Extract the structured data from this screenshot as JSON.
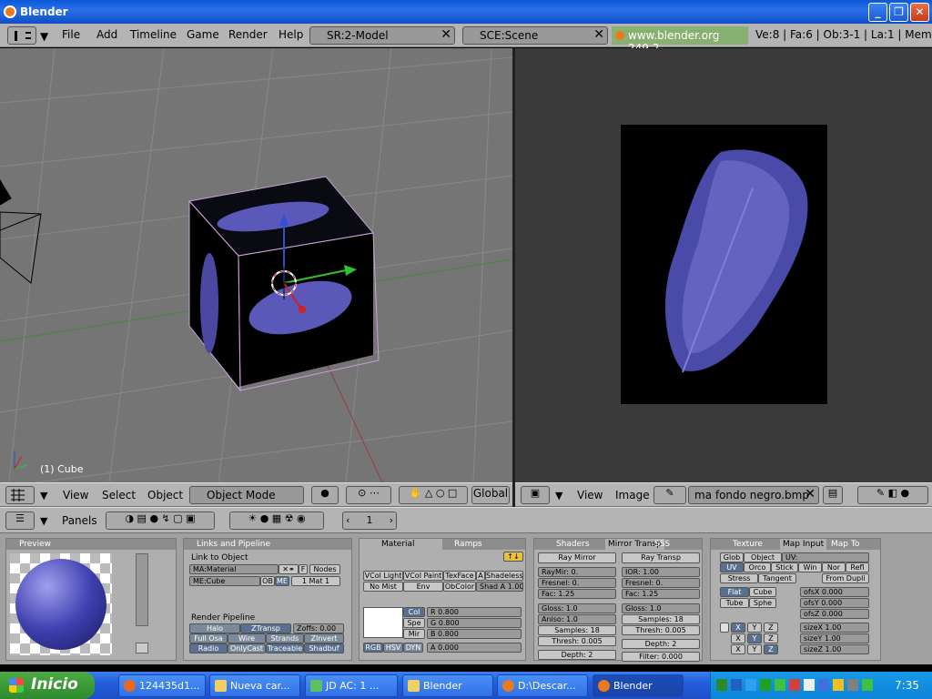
{
  "window": {
    "title": "Blender",
    "minimize": "_",
    "maximize": "❐",
    "close": "✕"
  },
  "menubar": {
    "items": [
      "File",
      "Add",
      "Timeline",
      "Game",
      "Render",
      "Help"
    ],
    "screen_field": "SR:2-Model",
    "scene_field": "SCE:Scene",
    "website": "www.blender.org 249.2",
    "stats": "Ve:8 | Fa:6 | Ob:3-1 | La:1  | Mem"
  },
  "viewport": {
    "object_label": "(1) Cube",
    "header": {
      "menus": [
        "View",
        "Select",
        "Object"
      ],
      "mode": "Object Mode",
      "orientation": "Global"
    }
  },
  "imageview": {
    "header": {
      "menus": [
        "View",
        "Image"
      ],
      "image_name": "ma fondo negro.bmp"
    }
  },
  "buttons_header": {
    "panels_label": "Panels",
    "frame": "1"
  },
  "preview": {
    "title": "Preview"
  },
  "links": {
    "title": "Links and Pipeline",
    "link_to_object": "Link to Object",
    "material_name": "MA:Material",
    "f_btn": "F",
    "nodes_btn": "Nodes",
    "mesh_name": "ME:Cube",
    "ob_btn": "OB",
    "me_btn": "ME",
    "mat_count": "1 Mat 1",
    "render_pipeline": "Render Pipeline",
    "pipeline_buttons": [
      "Halo",
      "ZTransp",
      "Zoffs: 0.00",
      "Full Osa",
      "Wire",
      "Strands",
      "ZInvert",
      "Radio",
      "OnlyCast",
      "Traceable",
      "Shadbuf"
    ]
  },
  "material": {
    "tabs": [
      "Material",
      "Ramps"
    ],
    "row1": [
      "VCol Light",
      "VCol Paint",
      "TexFace",
      "A",
      "Shadeless"
    ],
    "row2": [
      "No Mist",
      "Env",
      "ObColor",
      "Shad A 1.00"
    ],
    "col_labels": [
      "Col",
      "Spe",
      "Mir"
    ],
    "rgb": [
      "R 0.800",
      "G 0.800",
      "B 0.800"
    ],
    "modes": [
      "RGB",
      "HSV",
      "DYN"
    ],
    "alpha": "A 0.000"
  },
  "shaders": {
    "tabs": [
      "Shaders",
      "Mirror Transp",
      "SSS"
    ],
    "ray_mirror": "Ray Mirror",
    "ray_transp": "Ray Transp",
    "left": [
      "RayMir: 0.",
      "Fresnel: 0.",
      "Fac: 1.25",
      "Gloss: 1.0",
      "Aniso: 1.0",
      "Samples: 18",
      "Thresh: 0.005",
      "Depth: 2"
    ],
    "right": [
      "IOR: 1.00",
      "Fresnel: 0.",
      "Fac: 1.25",
      "Gloss: 1.0",
      "Samples: 18",
      "Thresh: 0.005",
      "Depth: 2",
      "Filter: 0.000"
    ]
  },
  "texture": {
    "tabs": [
      "Texture",
      "Map Input",
      "Map To"
    ],
    "row1": [
      "Glob",
      "Object",
      "UV:"
    ],
    "row2": [
      "UV",
      "Orco",
      "Stick",
      "Win",
      "Nor",
      "Refl"
    ],
    "row3": [
      "Stress",
      "Tangent",
      "From Dupli"
    ],
    "row4": [
      "Flat",
      "Cube"
    ],
    "row5": [
      "Tube",
      "Sphe"
    ],
    "ofs": [
      "ofsX 0.000",
      "ofsY 0.000",
      "ofsZ 0.000"
    ],
    "xyz": [
      "X",
      "Y",
      "Z"
    ],
    "size": [
      "sizeX 1.00",
      "sizeY 1.00",
      "sizeZ 1.00"
    ]
  },
  "taskbar": {
    "start": "Inicio",
    "buttons": [
      "124435d1...",
      "Nueva car...",
      "JD AC: 1 ...",
      "Blender",
      "D:\\Descar...",
      "Blender"
    ],
    "clock": "7:35"
  }
}
